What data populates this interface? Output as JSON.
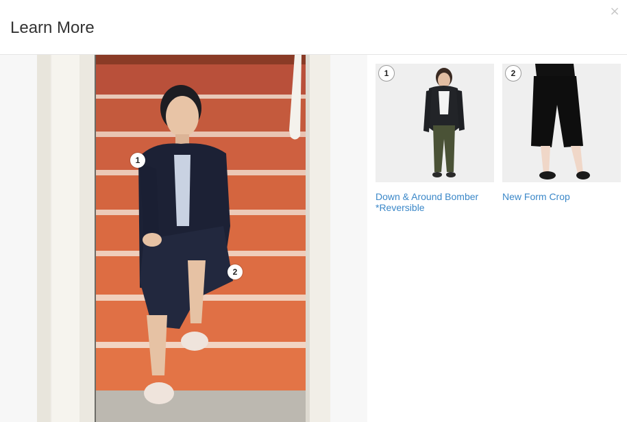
{
  "modal": {
    "title": "Learn More",
    "close_label": "×"
  },
  "hotspots": [
    {
      "number": "1"
    },
    {
      "number": "2"
    }
  ],
  "products": [
    {
      "number": "1",
      "name": "Down & Around Bomber *Reversible"
    },
    {
      "number": "2",
      "name": "New Form Crop"
    }
  ],
  "colors": {
    "link": "#3a87c8",
    "stairs": "#d9653f",
    "divider": "#e5e5e5",
    "left_panel_bg": "#f7f7f7"
  },
  "icons": {
    "close": "close-icon"
  }
}
